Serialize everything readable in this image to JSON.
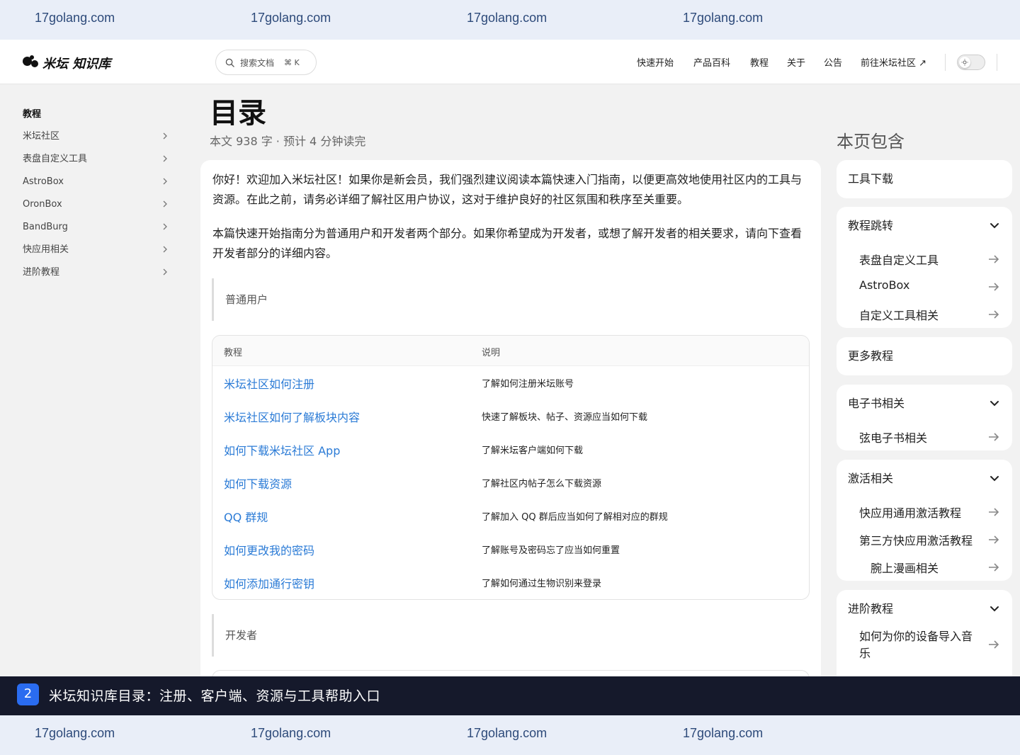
{
  "watermark": {
    "text": "17golang.com"
  },
  "header": {
    "logo_text": "米坛 知识库",
    "search": {
      "placeholder": "搜索文档",
      "shortcut": "⌘ K"
    },
    "nav": [
      "快速开始",
      "产品百科",
      "教程",
      "关于",
      "公告",
      "前往米坛社区 ↗"
    ]
  },
  "sidebar": {
    "title": "教程",
    "items": [
      "米坛社区",
      "表盘自定义工具",
      "AstroBox",
      "OronBox",
      "BandBurg",
      "快应用相关",
      "进阶教程"
    ]
  },
  "main": {
    "title": "目录",
    "meta": "本文 938 字 · 预计 4 分钟读完",
    "para1": "你好！欢迎加入米坛社区！如果你是新会员，我们强烈建议阅读本篇快速入门指南，以便更高效地使用社区内的工具与资源。在此之前，请务必详细了解社区用户协议，这对于维护良好的社区氛围和秩序至关重要。",
    "para2": "本篇快速开始指南分为普通用户和开发者两个部分。如果你希望成为开发者，或想了解开发者的相关要求，请向下查看开发者部分的详细内容。",
    "section1": "普通用户",
    "section2": "开发者",
    "table": {
      "headers": [
        "教程",
        "说明"
      ],
      "rows": [
        [
          "米坛社区如何注册",
          "了解如何注册米坛账号"
        ],
        [
          "米坛社区如何了解板块内容",
          "快速了解板块、帖子、资源应当如何下载"
        ],
        [
          "如何下载米坛社区 App",
          "了解米坛客户端如何下载"
        ],
        [
          "如何下载资源",
          "了解社区内帖子怎么下载资源"
        ],
        [
          "QQ 群规",
          "了解加入 QQ 群后应当如何了解相对应的群规"
        ],
        [
          "如何更改我的密码",
          "了解账号及密码忘了应当如何重置"
        ],
        [
          "如何添加通行密钥",
          "了解如何通过生物识别来登录"
        ]
      ]
    }
  },
  "toc": {
    "title": "本页包含",
    "sections": [
      {
        "label": "工具下载",
        "items": []
      },
      {
        "label": "教程跳转",
        "items": [
          "表盘自定义工具",
          "AstroBox",
          "自定义工具相关"
        ]
      },
      {
        "label": "更多教程",
        "items": []
      },
      {
        "label": "电子书相关",
        "items": [
          "弦电子书相关"
        ]
      },
      {
        "label": "激活相关",
        "items": [
          "快应用通用激活教程",
          "第三方快应用激活教程",
          "腕上漫画相关"
        ]
      },
      {
        "label": "进阶教程",
        "items": [
          "如何为你的设备导入音乐"
        ]
      }
    ]
  },
  "caption": {
    "badge": "2",
    "text": "米坛知识库目录：注册、客户端、资源与工具帮助入口"
  },
  "colors": {
    "link": "#2b7bd6",
    "caption_bg": "#15192b",
    "badge": "#2a6cf0",
    "watermark_bg": "#e9eef8"
  }
}
